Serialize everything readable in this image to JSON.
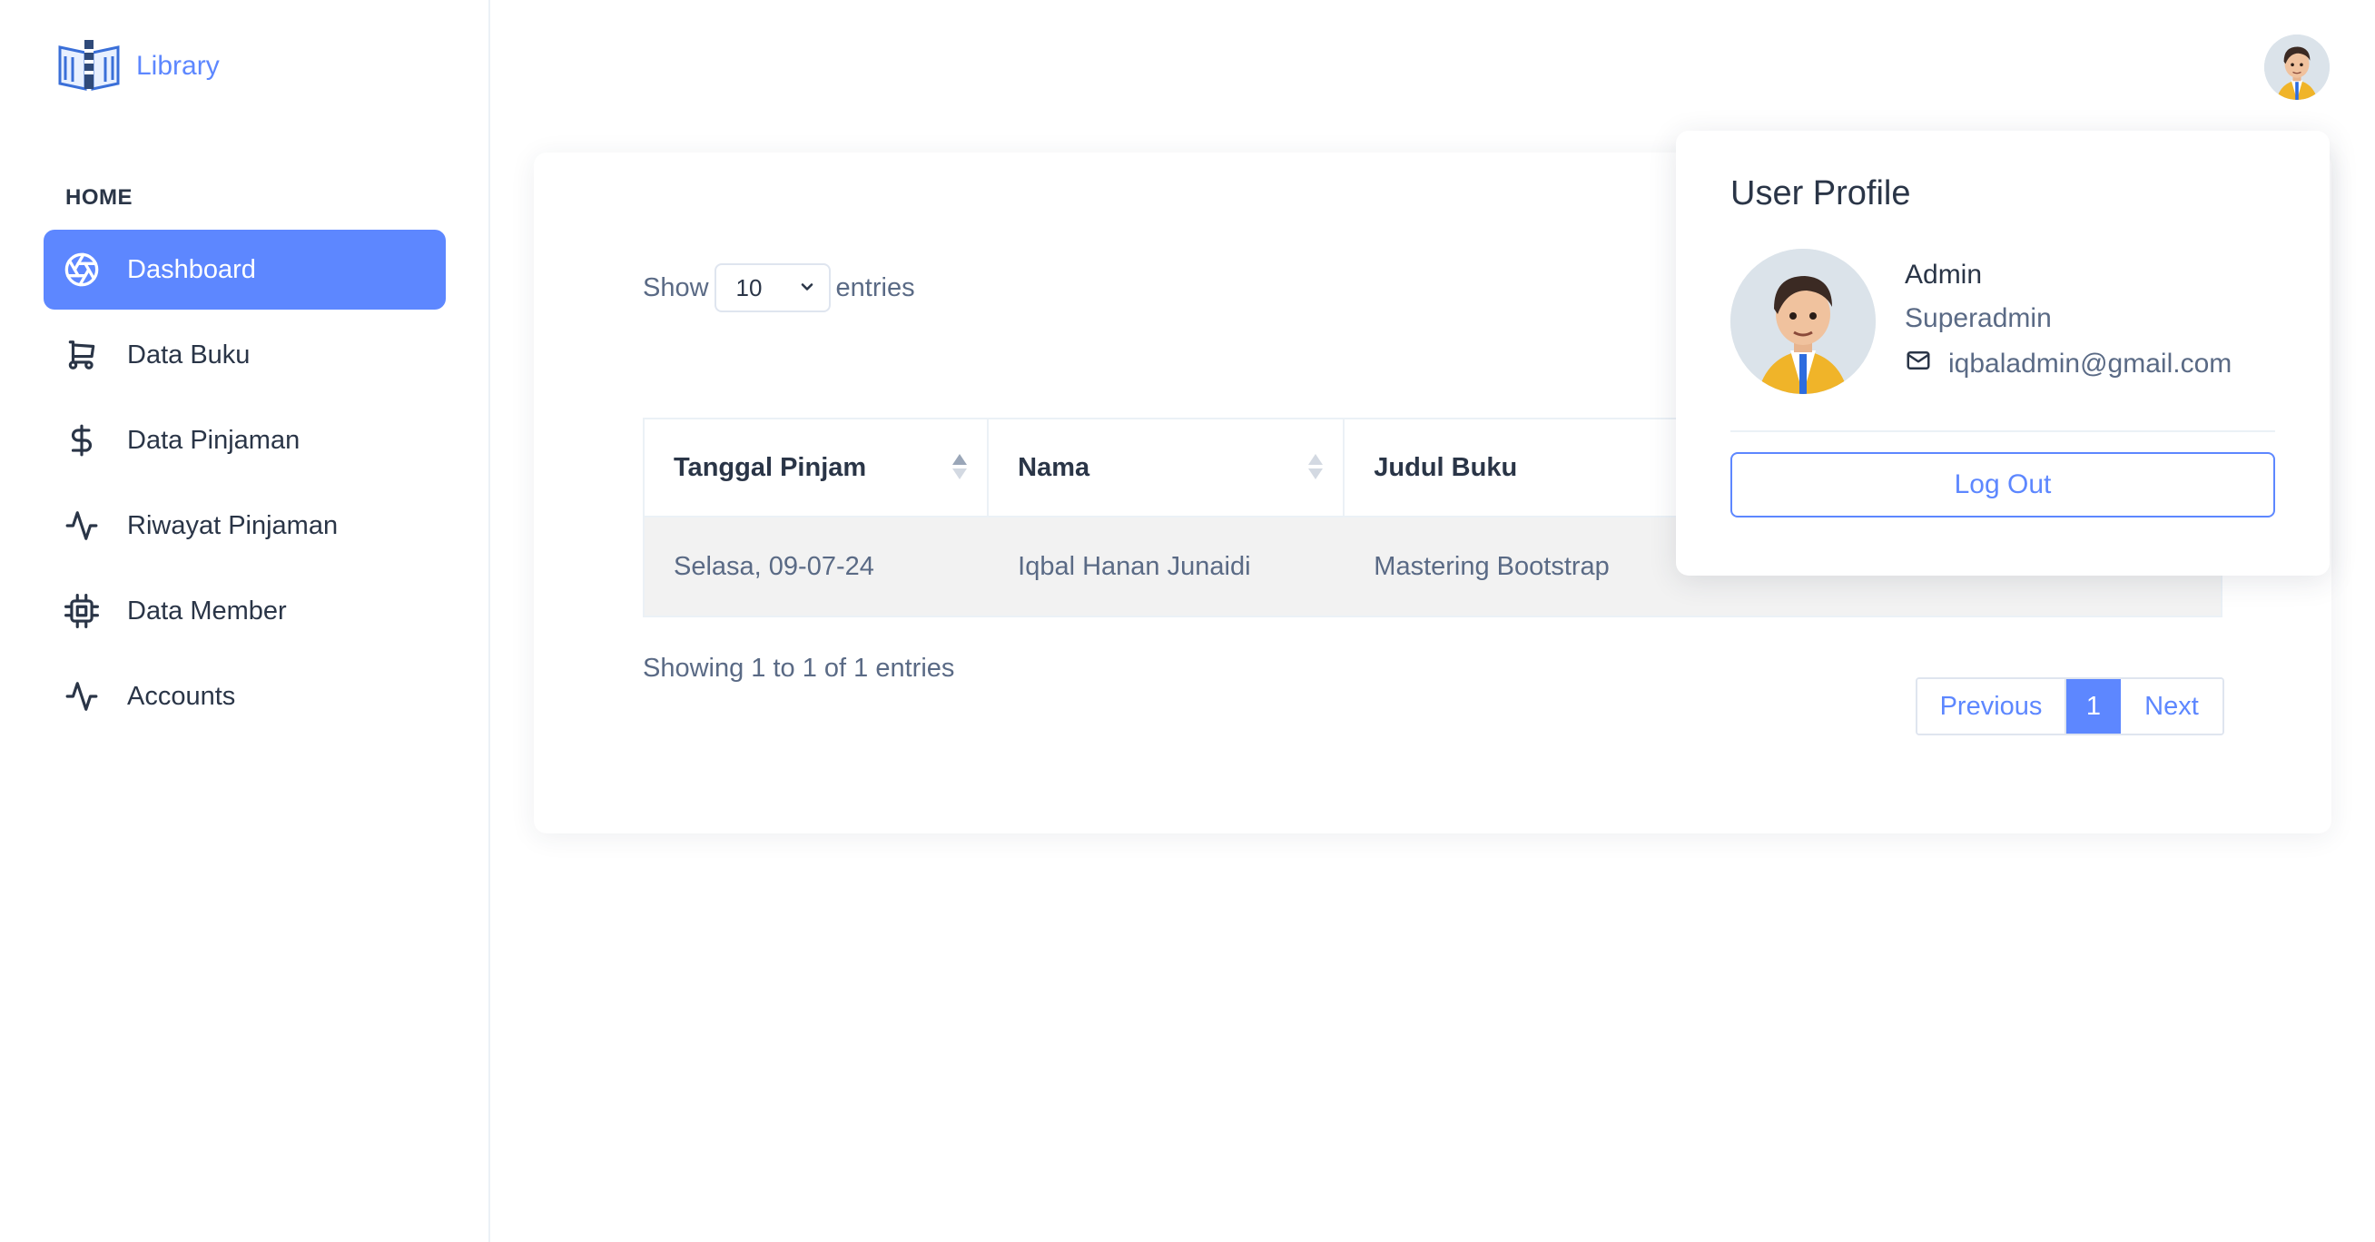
{
  "brand": {
    "name": "Library",
    "color": "#5d87ff"
  },
  "sidebar": {
    "section": "HOME",
    "items": [
      {
        "label": "Dashboard",
        "icon": "aperture-icon",
        "active": true
      },
      {
        "label": "Data Buku",
        "icon": "shopping-cart-icon"
      },
      {
        "label": "Data Pinjaman",
        "icon": "dollar-icon"
      },
      {
        "label": "Riwayat Pinjaman",
        "icon": "activity-icon"
      },
      {
        "label": "Data Member",
        "icon": "cpu-icon"
      },
      {
        "label": "Accounts",
        "icon": "activity-icon"
      }
    ]
  },
  "table_controls": {
    "show_label": "Show",
    "entries_value": "10",
    "entries_label": "entries"
  },
  "table": {
    "columns": [
      "Tanggal Pinjam",
      "Nama",
      "Judul Buku"
    ],
    "rows": [
      [
        "Selasa, 09-07-24",
        "Iqbal Hanan Junaidi",
        "Mastering Bootstrap"
      ]
    ]
  },
  "footer": {
    "info": "Showing 1 to 1 of 1 entries"
  },
  "pagination": {
    "previous": "Previous",
    "current": "1",
    "next": "Next"
  },
  "profile": {
    "title": "User Profile",
    "name": "Admin",
    "role": "Superadmin",
    "email": "iqbaladmin@gmail.com",
    "logout": "Log Out"
  }
}
